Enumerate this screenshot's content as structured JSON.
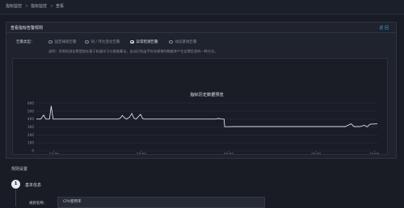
{
  "breadcrumb": {
    "items": [
      "指标监控",
      "指标监控",
      "查看"
    ],
    "separator": ">"
  },
  "panel": {
    "title": "查看指标告警规则",
    "back_label": "返 回"
  },
  "alarm_type": {
    "label": "告警类型：",
    "options": [
      {
        "label": "固定阈值告警",
        "selected": false
      },
      {
        "label": "同 / 环比变化告警",
        "selected": false
      },
      {
        "label": "异常检测告警",
        "selected": true
      },
      {
        "label": "动态基线告警",
        "selected": false
      }
    ],
    "description": "说明：异常检测告警是指在基于机器学习与智能算法，自动识别出不符合规律的数据并产生告警信息的一种方式。"
  },
  "chart_data": {
    "type": "line",
    "title": "指标历史数据预览",
    "ylim": [
      0,
      600
    ],
    "yticks": [
      "0",
      "100",
      "200",
      "300",
      "400",
      "500",
      "600"
    ],
    "x_ticks": [
      {
        "time": "12:00",
        "date": "2019-11-29"
      },
      {
        "time": "18:00",
        "date": "2019-11-29"
      },
      {
        "time": "00:00",
        "date": "2019-11-30"
      },
      {
        "time": "06:00",
        "date": "2019-11-30"
      },
      {
        "time": "10:00",
        "date": "2019-11-30"
      }
    ],
    "x_hours": [
      0,
      6,
      12,
      18,
      22
    ],
    "xlim_hours": [
      -1.2,
      22.2
    ],
    "grid": true,
    "series": [
      {
        "color": "#d9dde4",
        "points": [
          [
            -1.2,
            400
          ],
          [
            -0.9,
            400
          ],
          [
            -0.7,
            450
          ],
          [
            -0.55,
            400
          ],
          [
            -0.3,
            400
          ],
          [
            -0.18,
            565
          ],
          [
            -0.05,
            400
          ],
          [
            1.5,
            400
          ],
          [
            3.0,
            400
          ],
          [
            4.4,
            400
          ],
          [
            4.55,
            410
          ],
          [
            4.7,
            445
          ],
          [
            4.85,
            415
          ],
          [
            5.0,
            400
          ],
          [
            5.2,
            425
          ],
          [
            5.35,
            470
          ],
          [
            5.5,
            410
          ],
          [
            5.65,
            400
          ],
          [
            5.8,
            430
          ],
          [
            5.95,
            460
          ],
          [
            6.1,
            405
          ],
          [
            6.3,
            400
          ],
          [
            8.0,
            400
          ],
          [
            9.5,
            400
          ],
          [
            10.5,
            400
          ],
          [
            11.1,
            400
          ],
          [
            11.3,
            408
          ],
          [
            11.5,
            400
          ],
          [
            11.68,
            400
          ],
          [
            11.72,
            303
          ],
          [
            12.5,
            305
          ],
          [
            14.0,
            305
          ],
          [
            16.0,
            305
          ],
          [
            18.0,
            305
          ],
          [
            19.0,
            305
          ],
          [
            20.0,
            305
          ],
          [
            20.4,
            340
          ],
          [
            20.6,
            305
          ],
          [
            21.0,
            305
          ],
          [
            21.3,
            322
          ],
          [
            21.5,
            302
          ],
          [
            21.7,
            335
          ],
          [
            22.2,
            340
          ]
        ]
      }
    ]
  },
  "rule_settings": {
    "section_title": "规则设置",
    "step_number": "1",
    "step_title": "基本信息",
    "rule_name_label": "规则名称：",
    "rule_name_value": "CPU使用率"
  }
}
